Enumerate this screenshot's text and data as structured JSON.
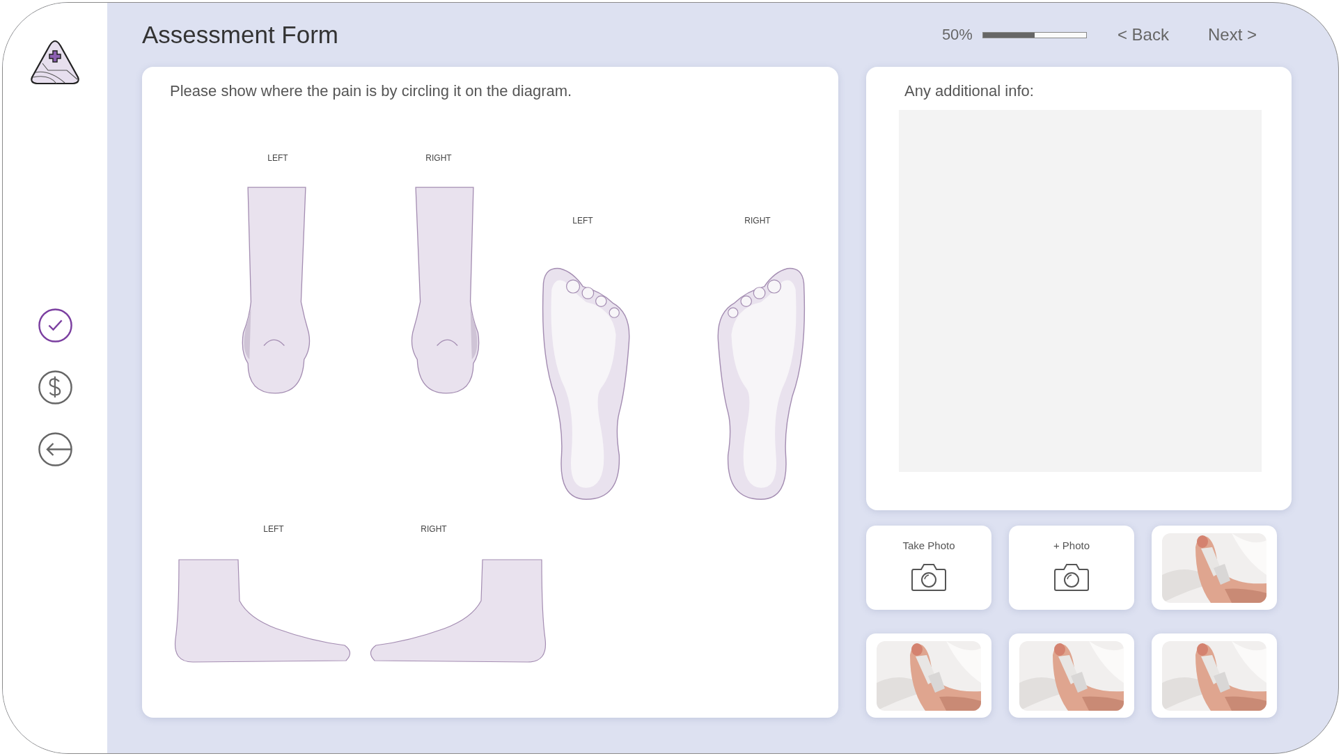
{
  "sidebar": {
    "items": [
      {
        "kind": "check",
        "selected": true
      },
      {
        "kind": "dollar",
        "selected": false
      },
      {
        "kind": "back",
        "selected": false
      }
    ]
  },
  "header": {
    "title": "Assessment Form",
    "progress": {
      "reading": "50%",
      "level": 0.5
    },
    "nav": [
      "< Back",
      "Next >"
    ]
  },
  "diagram": {
    "instruction": "Please show where the pain is by circling it on the diagram.",
    "views": [
      {
        "kind": "back",
        "labels": [
          "LEFT",
          "RIGHT"
        ]
      },
      {
        "kind": "sole",
        "labels": [
          "LEFT",
          "RIGHT"
        ]
      },
      {
        "kind": "side",
        "labels": [
          "LEFT",
          "RIGHT"
        ]
      }
    ]
  },
  "notes": {
    "label": "Any additional info:"
  },
  "photos": [
    {
      "kind": "action",
      "label": "Take Photo"
    },
    {
      "kind": "action",
      "label": "+ Photo"
    },
    {
      "kind": "picture"
    },
    {
      "kind": "picture"
    },
    {
      "kind": "picture"
    },
    {
      "kind": "picture"
    }
  ]
}
